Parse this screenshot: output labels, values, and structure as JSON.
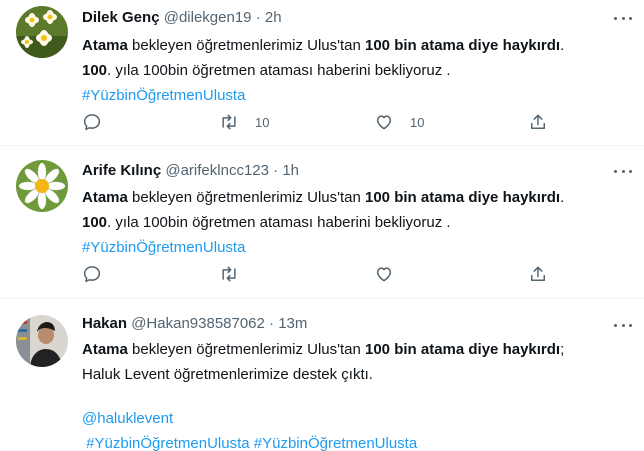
{
  "tweets": [
    {
      "name": "Dilek Genç",
      "handle": "@dilekgen19",
      "dot": "·",
      "time": "2h",
      "line1_a": "Atama",
      "line1_b": " bekleyen öğretmenlerimiz Ulus'tan ",
      "line1_c": "100 bin atama diye haykırdı",
      "line1_d": ".",
      "line2_a": "100",
      "line2_b": ". yıla 100bin öğretmen ataması haberini bekliyoruz .",
      "hashtag": "#YüzbinÖğretmenUlusta",
      "retweets": "10",
      "likes": "10"
    },
    {
      "name": "Arife Kılınç",
      "handle": "@arifeklncc123",
      "dot": "·",
      "time": "1h",
      "line1_a": "Atama",
      "line1_b": " bekleyen öğretmenlerimiz Ulus'tan ",
      "line1_c": "100 bin atama diye haykırdı",
      "line1_d": ".",
      "line2_a": "100",
      "line2_b": ". yıla 100bin öğretmen ataması haberini bekliyoruz .",
      "hashtag": "#YüzbinÖğretmenUlusta"
    },
    {
      "name": "Hakan",
      "handle": "@Hakan938587062",
      "dot": "·",
      "time": "13m",
      "line1_a": "Atama",
      "line1_b": " bekleyen öğretmenlerimiz Ulus'tan ",
      "line1_c": "100 bin atama diye haykırdı",
      "line1_d": ";",
      "line2": "Haluk Levent öğretmenlerimize destek çıktı.",
      "mention": "@haluklevent",
      "hashtag1": "#YüzbinÖğretmenUlusta",
      "hashtag2": "#YüzbinÖğretmenUlusta"
    }
  ],
  "colors": {
    "link": "#1d9bf0",
    "muted": "#536471",
    "text": "#0f1419"
  },
  "icons": [
    "reply-icon",
    "retweet-icon",
    "like-icon",
    "share-icon",
    "more-icon"
  ]
}
